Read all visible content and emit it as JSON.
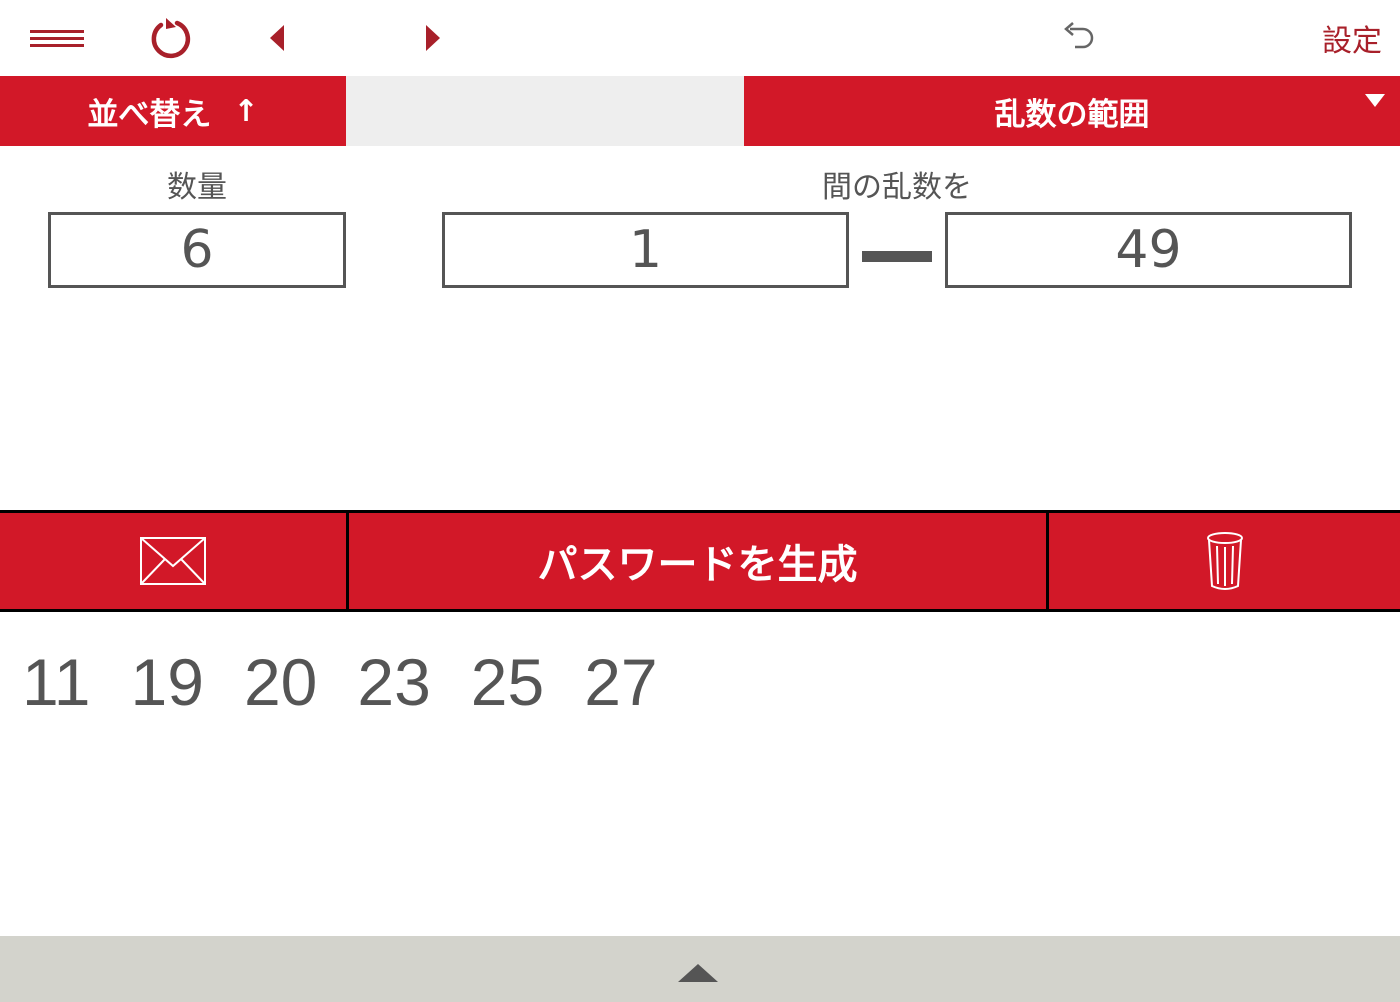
{
  "toolbar": {
    "menu_icon": "hamburger-icon",
    "refresh_icon": "refresh-icon",
    "prev_icon": "triangle-left-icon",
    "next_icon": "triangle-right-icon",
    "undo_icon": "undo-icon",
    "settings_label": "設定"
  },
  "tabs": {
    "sort_label": "並べ替え",
    "sort_arrow": "↑",
    "range_label": "乱数の範囲",
    "range_dropdown_icon": "triangle-down-icon"
  },
  "settings": {
    "quantity_label": "数量",
    "quantity_value": "6",
    "between_label": "間の乱数を",
    "min_value": "1",
    "max_value": "49"
  },
  "actions": {
    "mail_icon": "envelope-icon",
    "generate_label": "パスワードを生成",
    "trash_icon": "trash-icon"
  },
  "results": [
    "11",
    "19",
    "20",
    "23",
    "25",
    "27"
  ],
  "bottom": {
    "expand_icon": "triangle-up-icon"
  },
  "colors": {
    "accent_red": "#d21828",
    "dark_red": "#a8202a",
    "text_gray": "#555555",
    "bottom_bar": "#d3d3cc"
  }
}
